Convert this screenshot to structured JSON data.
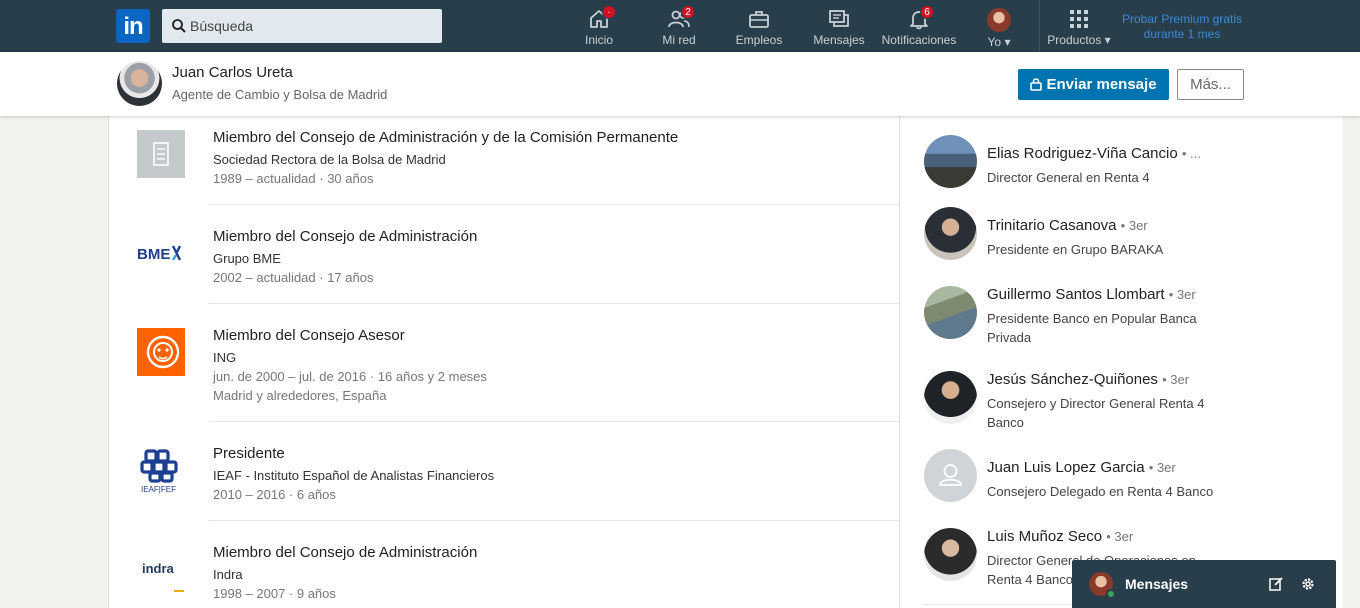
{
  "nav": {
    "search_placeholder": "Búsqueda",
    "items": [
      {
        "label": "Inicio",
        "badge": "·"
      },
      {
        "label": "Mi red",
        "badge": "2"
      },
      {
        "label": "Empleos",
        "badge": ""
      },
      {
        "label": "Mensajes",
        "badge": ""
      },
      {
        "label": "Notificaciones",
        "badge": "6"
      },
      {
        "label": "Yo",
        "badge": ""
      },
      {
        "label": "Productos",
        "badge": ""
      }
    ],
    "premium_line1": "Probar Premium gratis",
    "premium_line2": "durante 1 mes"
  },
  "profile": {
    "name": "Juan Carlos Ureta",
    "headline": "Agente de Cambio y Bolsa de Madrid",
    "message_button": "Enviar mensaje",
    "more_button": "Más..."
  },
  "experience": [
    {
      "title": "Miembro del Consejo de Administración y de la Comisión Permanente",
      "company": "Sociedad Rectora de la Bolsa de Madrid",
      "dates": "1989 – actualidad · 30 años",
      "location": ""
    },
    {
      "title": "Miembro del Consejo de Administración",
      "company": "Grupo BME",
      "dates": "2002 – actualidad · 17 años",
      "location": ""
    },
    {
      "title": "Miembro del Consejo Asesor",
      "company": "ING",
      "dates": "jun. de 2000 – jul. de 2016 · 16 años y 2 meses",
      "location": "Madrid y alrededores, España"
    },
    {
      "title": "Presidente",
      "company": "IEAF - Instituto Español de Analistas Financieros",
      "dates": "2010 – 2016 · 6 años",
      "location": ""
    },
    {
      "title": "Miembro del Consejo de Administración",
      "company": "Indra",
      "dates": "1998 – 2007 · 9 años",
      "location": ""
    }
  ],
  "logos": {
    "bme": "BME",
    "ieaf": "IEAF|FEF",
    "indra": "indra"
  },
  "people": [
    {
      "name": "Elias Rodriguez-Viña Cancio",
      "degree": "• ...",
      "line1": "Director General en Renta 4",
      "line2": ""
    },
    {
      "name": "Trinitario Casanova",
      "degree": "• 3er",
      "line1": "Presidente en Grupo BARAKA",
      "line2": ""
    },
    {
      "name": "Guillermo Santos Llombart",
      "degree": "• 3er",
      "line1": "Presidente Banco en Popular Banca",
      "line2": "Privada"
    },
    {
      "name": "Jesús Sánchez-Quiñones",
      "degree": "• 3er",
      "line1": "Consejero y Director General Renta 4",
      "line2": "Banco"
    },
    {
      "name": "Juan Luis Lopez Garcia",
      "degree": "• 3er",
      "line1": "Consejero Delegado en Renta 4 Banco",
      "line2": ""
    },
    {
      "name": "Luis Muñoz Seco",
      "degree": "• 3er",
      "line1": "Director General de Operaciones en",
      "line2": "Renta 4 Banco"
    }
  ],
  "messaging": {
    "label": "Mensajes"
  },
  "colors": {
    "nav_bg": "#283e4a",
    "primary": "#0073b1",
    "badge": "#d11124",
    "ing_orange": "#ff6200"
  }
}
